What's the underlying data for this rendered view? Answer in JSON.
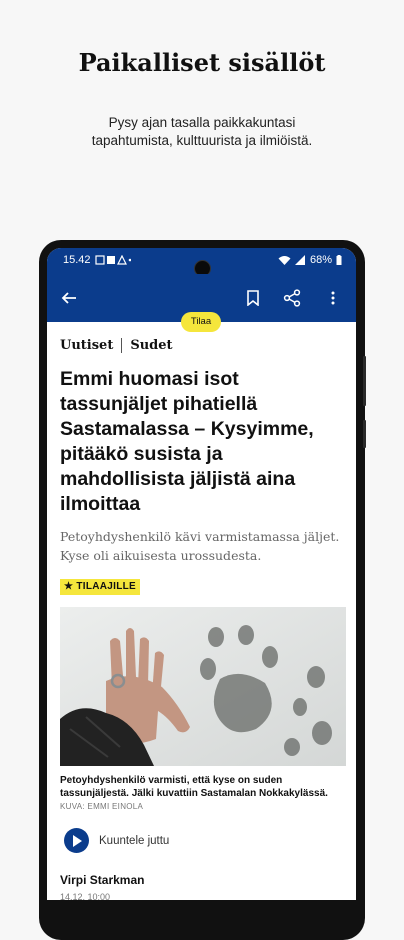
{
  "promo": {
    "title": "Paikalliset sisällöt",
    "subtitle_line1": "Pysy ajan tasalla paikkakuntasi",
    "subtitle_line2": "tapahtumista, kulttuurista ja ilmiöistä."
  },
  "status_bar": {
    "time": "15.42",
    "battery": "68%"
  },
  "app_bar": {
    "subscribe_label": "Tilaa"
  },
  "article": {
    "section": "Uutiset",
    "tag": "Sudet",
    "headline": "Emmi huomasi isot tassunjäljet pihatiellä Sastamalassa – Kysyimme, pitääkö susista ja mahdollisista jäljistä aina ilmoittaa",
    "lead": "Petoyhdyshenkilö kävi varmistamassa jäljet. Kyse oli aikuisesta urossudesta.",
    "badge": "TILAAJILLE",
    "caption": "Petoyhdyshenkilö varmisti, että kyse on suden tassunjäljestä. Jälki kuvattiin Sastamalan Nokkakylässä.",
    "photo_credit": "KUVA: EMMI EINOLA",
    "listen_label": "Kuuntele juttu",
    "author": "Virpi Starkman",
    "date": "14.12. 10:00"
  },
  "colors": {
    "brand_blue": "#0b3c8c",
    "accent_yellow": "#f5e63c"
  },
  "icons": [
    "back-arrow-icon",
    "bookmark-icon",
    "share-icon",
    "more-vert-icon",
    "play-icon",
    "star-icon",
    "wifi-icon",
    "signal-icon",
    "battery-icon"
  ]
}
